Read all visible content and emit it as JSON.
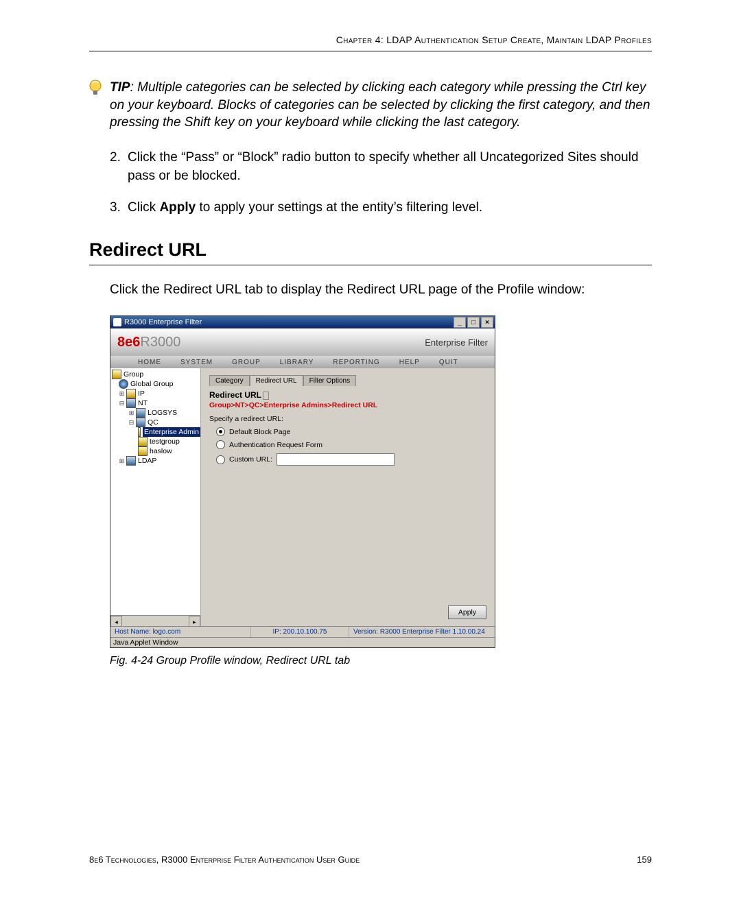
{
  "header": "Chapter 4: LDAP Authentication Setup   Create, Maintain LDAP Profiles",
  "tip_label": "TIP",
  "tip_text": ": Multiple categories can be selected by clicking each category while pressing the Ctrl key on your keyboard. Blocks of categories can be selected by clicking the first category, and then pressing the Shift key on your keyboard while clicking the last category.",
  "step2_num": "2.",
  "step2_text": "Click the “Pass” or “Block” radio button to specify whether all Uncategorized Sites should pass or be blocked.",
  "step3_num": "3.",
  "step3_pre": "Click ",
  "step3_bold": "Apply",
  "step3_post": " to apply your settings at the entity’s filtering level.",
  "h2": "Redirect URL",
  "intro_para": "Click the Redirect URL tab to display the Redirect URL page of the Profile window:",
  "app": {
    "title": "R3000 Enterprise Filter",
    "brand_main": "8e6",
    "brand_sub": "R3000",
    "brand_right": "Enterprise Filter",
    "menu": {
      "home": "HOME",
      "system": "SYSTEM",
      "group": "GROUP",
      "library": "LIBRARY",
      "reporting": "REPORTING",
      "help": "HELP",
      "quit": "QUIT"
    },
    "tree": {
      "root": "Group",
      "global": "Global Group",
      "ip": "IP",
      "nt": "NT",
      "logsys": "LOGSYS",
      "qc": "QC",
      "entadmin": "Enterprise Admin",
      "testgroup": "testgroup",
      "haslow": "haslow",
      "ldap": "LDAP"
    },
    "tabs": {
      "cat": "Category",
      "redir": "Redirect URL",
      "filter": "Filter Options"
    },
    "panel_title": "Redirect URL",
    "panel_badge": " ",
    "breadcrumb": "Group>NT>QC>Enterprise Admins>Redirect URL",
    "section": "Specify a redirect URL:",
    "opt_default": "Default Block Page",
    "opt_auth": "Authentication Request Form",
    "opt_custom": "Custom URL:",
    "apply": "Apply",
    "status_host": "Host Name: logo.com",
    "status_ip": "IP: 200.10.100.75",
    "status_ver": "Version: R3000 Enterprise Filter 1.10.00.24",
    "java": "Java Applet Window"
  },
  "fig_caption": "Fig. 4-24  Group Profile window, Redirect URL tab",
  "footer_left": "8e6 Technologies, R3000 Enterprise Filter Authentication User Guide",
  "footer_right": "159"
}
